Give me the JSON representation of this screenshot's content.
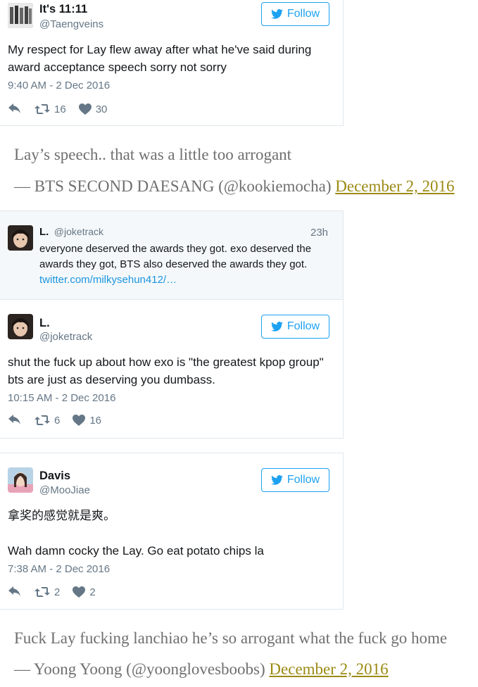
{
  "tweets": [
    {
      "name": "It's 11:11",
      "handle": "@Taengveins",
      "follow": "Follow",
      "text": "My respect for Lay flew away after what he've said during award acceptance speech sorry not sorry",
      "timestamp": "9:40 AM - 2 Dec 2016",
      "retweets": "16",
      "likes": "30"
    },
    {
      "name": "L.",
      "handle": "@joketrack",
      "follow": "Follow",
      "text": "shut the fuck up about how exo is \"the greatest kpop group\" bts are just as deserving you dumbass.",
      "timestamp": "10:15 AM - 2 Dec 2016",
      "retweets": "6",
      "likes": "16"
    },
    {
      "name": "Davis",
      "handle": "@MooJiae",
      "follow": "Follow",
      "text_line1": "拿奖的感觉就是爽。",
      "text_line2": "Wah damn cocky the Lay. Go eat potato chips la",
      "timestamp": "7:38 AM - 2 Dec 2016",
      "retweets": "2",
      "likes": "2"
    }
  ],
  "reply_context": {
    "name": "L.",
    "handle": "@joketrack",
    "time": "23h",
    "text": "everyone deserved the awards they got. exo deserved the awards they got, BTS also deserved the awards they got.",
    "link": "twitter.com/milkysehun412/…"
  },
  "quotes": [
    {
      "text": "Lay’s speech.. that was a little too arrogant",
      "attribution": "— BTS SECOND DAESANG (@kookiemocha)",
      "date": "December 2, 2016"
    },
    {
      "text": "Fuck Lay fucking lanchiao he’s so arrogant what the fuck go home",
      "attribution": "— Yoong Yoong (@yoonglovesboobs)",
      "date": "December 2, 2016"
    }
  ],
  "colors": {
    "twitter_blue": "#1da1f2",
    "link_gold": "#9b8a13",
    "muted": "#657786",
    "reply_bg": "#f5f8fa"
  },
  "icons": [
    "twitter-bird-icon",
    "reply-icon",
    "retweet-icon",
    "heart-icon"
  ]
}
